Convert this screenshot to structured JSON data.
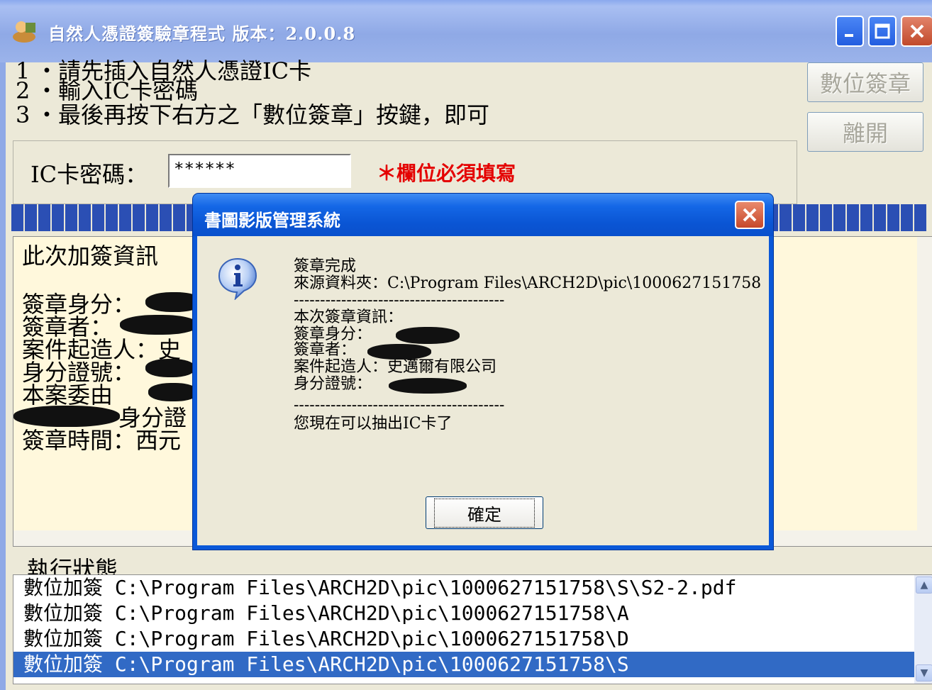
{
  "window": {
    "title": "自然人憑證簽驗章程式 版本：2.0.0.8",
    "accent": "#8fa9e6"
  },
  "instructions": [
    {
      "num": "1",
      "text": "・請先插入自然人憑證IC卡"
    },
    {
      "num": "2",
      "text": "・輸入IC卡密碼"
    },
    {
      "num": "3",
      "text": "・最後再按下右方之「數位簽章」按鍵，即可"
    }
  ],
  "buttons": {
    "sign_label": "數位簽章",
    "exit_label": "離開"
  },
  "password": {
    "label": "IC卡密碼：",
    "value": "******",
    "required_note": "＊欄位必須填寫",
    "required_color": "#e40000"
  },
  "info_panel": {
    "lines": [
      "此次加簽資訊",
      "簽章身分：",
      "簽章者：",
      "案件起造人：史",
      "身分證號：",
      "本案委由",
      "身分證",
      "簽章時間：西元"
    ]
  },
  "status": {
    "label": "執行狀態",
    "rows": [
      "數位加簽 C:\\Program Files\\ARCH2D\\pic\\1000627151758\\S\\S2-2.pdf",
      "數位加簽 C:\\Program Files\\ARCH2D\\pic\\1000627151758\\A",
      "數位加簽 C:\\Program Files\\ARCH2D\\pic\\1000627151758\\D",
      "數位加簽 C:\\Program Files\\ARCH2D\\pic\\1000627151758\\S"
    ],
    "selected_index": 3,
    "selected_color": "#316ac5"
  },
  "dialog": {
    "title": "書圖影版管理系統",
    "line_done": "簽章完成",
    "line_source": "來源資料夾：C:\\Program Files\\ARCH2D\\pic\\1000627151758",
    "separator": "----------------------------------------",
    "line_info": "本次簽章資訊：",
    "line_identity": "簽章身分：",
    "line_signer": "簽章者：",
    "line_applicant": "案件起造人：史邁爾有限公司",
    "line_id": "身分證號：",
    "separator2": "----------------------------------------",
    "line_remove": "您現在可以抽出IC卡了",
    "ok_label": "確定",
    "icon": "info-icon"
  }
}
